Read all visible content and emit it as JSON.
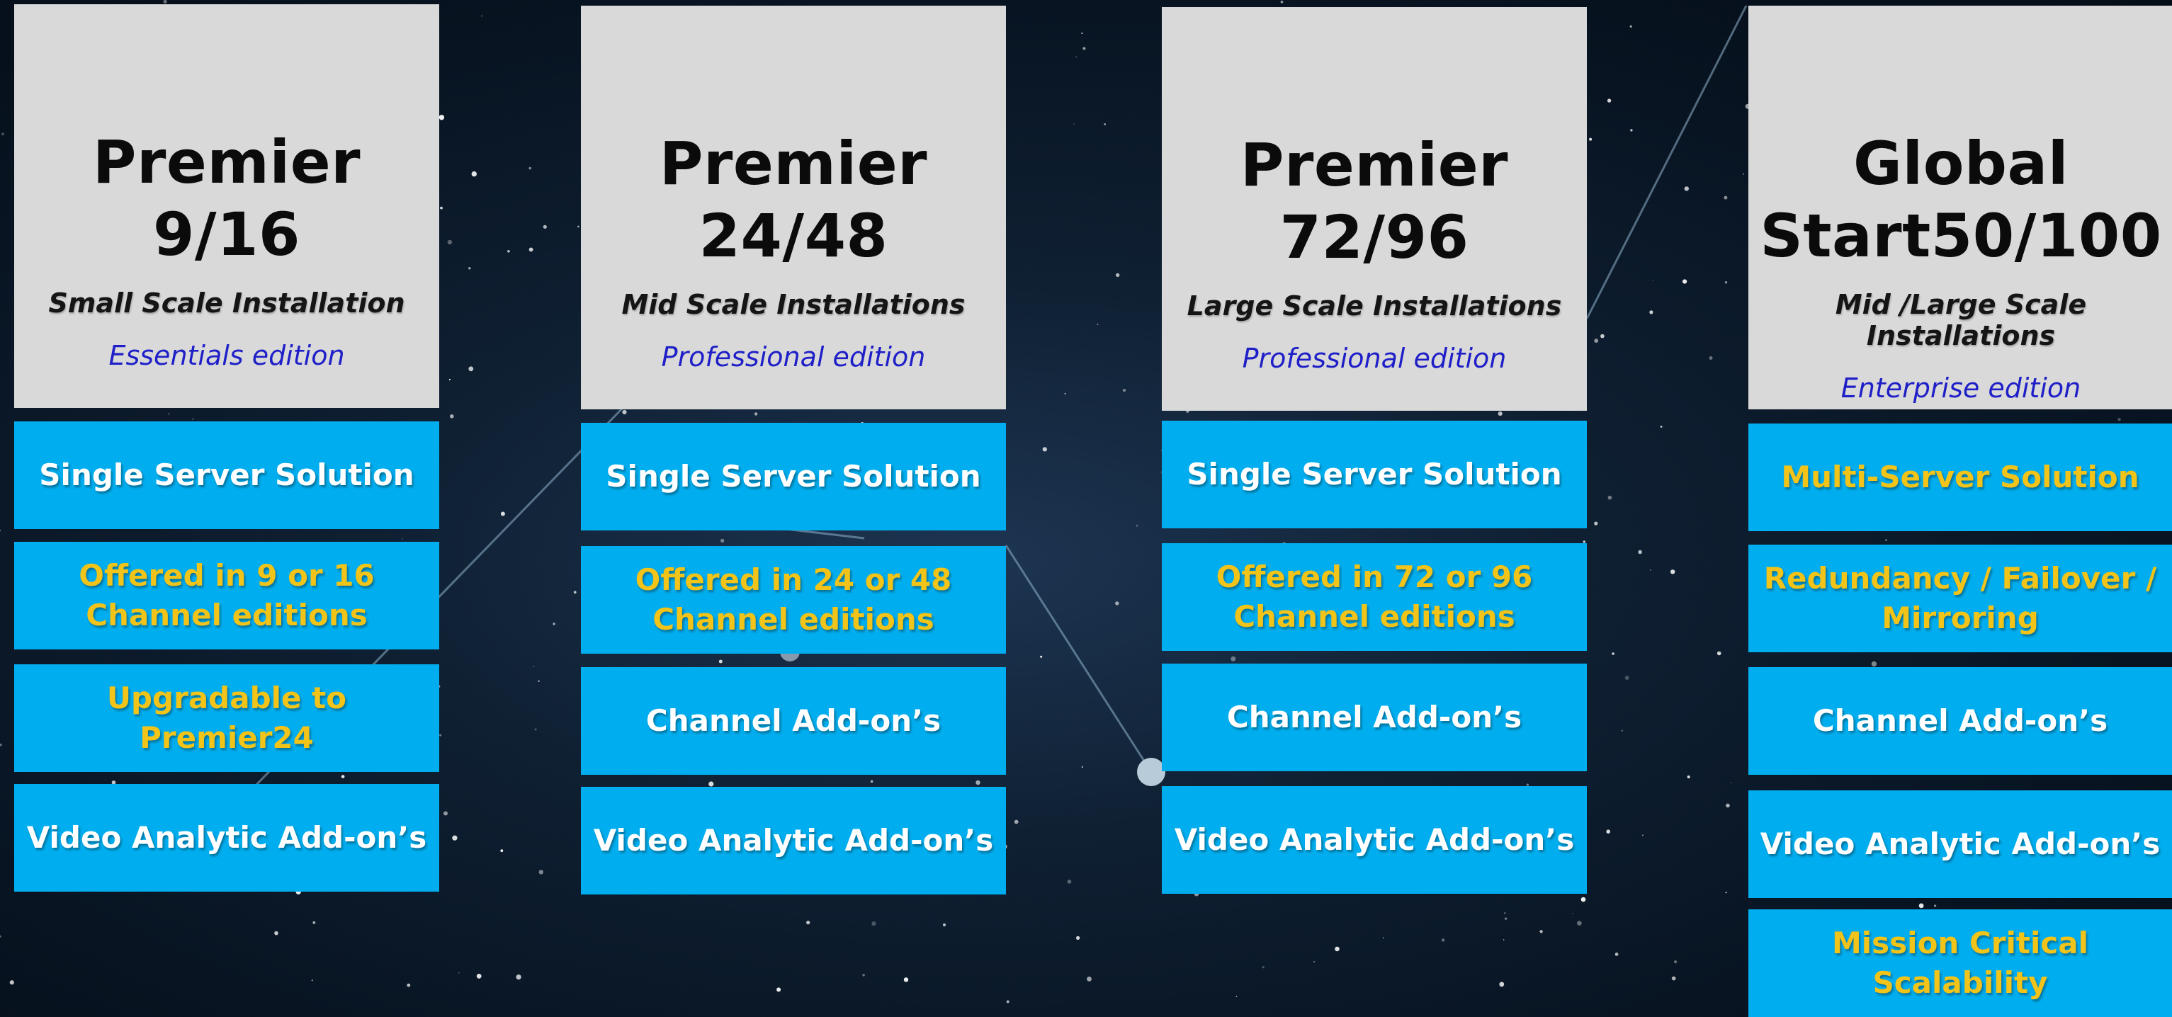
{
  "colors": {
    "header_bg": "#d9d9d9",
    "feature_bg": "#00aeef",
    "feature_text": "#ffffff",
    "highlight_text": "#f2c318",
    "edition_text": "#1f1fc8"
  },
  "columns": [
    {
      "title": "Premier\n9/16",
      "scale": "Small Scale Installation",
      "edition": "Essentials edition",
      "features": [
        {
          "label": "Single Server Solution",
          "highlight": false
        },
        {
          "label": "Offered in 9 or 16\nChannel editions",
          "highlight": true
        },
        {
          "label": "Upgradable to Premier24",
          "highlight": true
        },
        {
          "label": "Video Analytic Add-on’s",
          "highlight": false
        }
      ]
    },
    {
      "title": "Premier\n24/48",
      "scale": "Mid Scale Installations",
      "edition": "Professional edition",
      "features": [
        {
          "label": "Single Server Solution",
          "highlight": false
        },
        {
          "label": "Offered in 24 or 48\nChannel editions",
          "highlight": true
        },
        {
          "label": "Channel Add-on’s",
          "highlight": false
        },
        {
          "label": "Video Analytic Add-on’s",
          "highlight": false
        }
      ]
    },
    {
      "title": "Premier\n72/96",
      "scale": "Large Scale Installations",
      "edition": "Professional edition",
      "features": [
        {
          "label": "Single Server Solution",
          "highlight": false
        },
        {
          "label": "Offered in 72 or 96\nChannel editions",
          "highlight": true
        },
        {
          "label": "Channel Add-on’s",
          "highlight": false
        },
        {
          "label": "Video Analytic Add-on’s",
          "highlight": false
        }
      ]
    },
    {
      "title": "Global\nStart50/100",
      "scale": "Mid /Large Scale Installations",
      "edition": "Enterprise edition",
      "features": [
        {
          "label": "Multi-Server Solution",
          "highlight": true
        },
        {
          "label": "Redundancy / Failover /\nMirroring",
          "highlight": true
        },
        {
          "label": "Channel Add-on’s",
          "highlight": false
        },
        {
          "label": "Video Analytic Add-on’s",
          "highlight": false
        },
        {
          "label": "Mission Critical Scalability",
          "highlight": true
        }
      ]
    }
  ]
}
